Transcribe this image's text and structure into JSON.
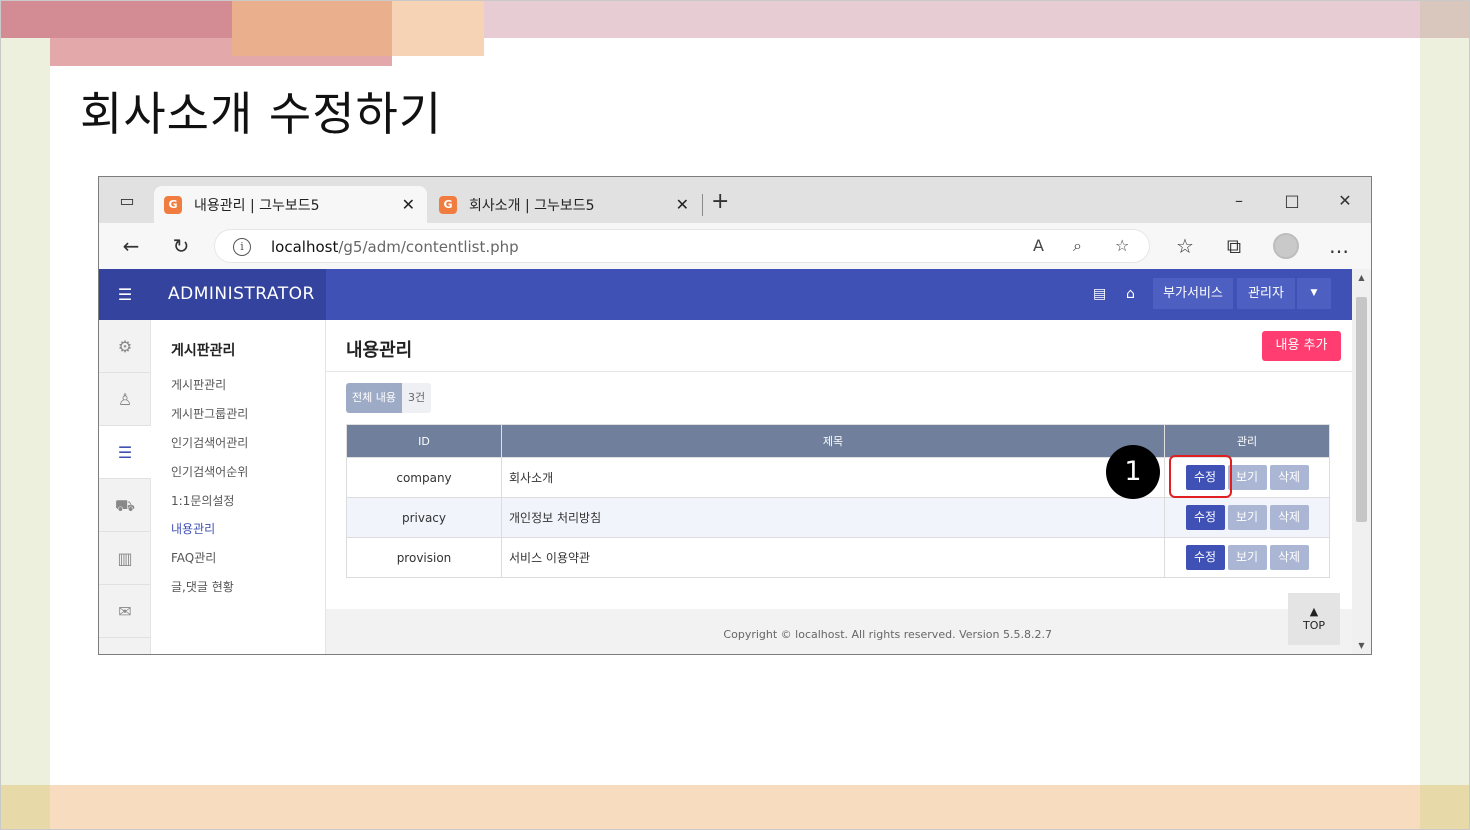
{
  "slide": {
    "title": "회사소개 수정하기",
    "step_number": "1"
  },
  "browser": {
    "tabs": [
      {
        "title": "내용관리 | 그누보드5",
        "active": true
      },
      {
        "title": "회사소개 | 그누보드5",
        "active": false
      }
    ],
    "url_host": "localhost",
    "url_path": "/g5/adm/contentlist.php"
  },
  "admin": {
    "brand": "ADMINISTRATOR",
    "header_buttons": {
      "addon": "부가서비스",
      "admin": "관리자"
    },
    "sidebar": {
      "title": "게시판관리",
      "items": [
        "게시판관리",
        "게시판그룹관리",
        "인기검색어관리",
        "인기검색어순위",
        "1:1문의설정",
        "내용관리",
        "FAQ관리",
        "글,댓글 현황"
      ],
      "active_item": "내용관리"
    },
    "page": {
      "title": "내용관리",
      "add_button": "내용 추가",
      "count_label": "전체 내용",
      "count_value": "3건"
    },
    "table": {
      "headers": [
        "ID",
        "제목",
        "관리"
      ],
      "rows": [
        {
          "id": "company",
          "title": "회사소개"
        },
        {
          "id": "privacy",
          "title": "개인정보 처리방침"
        },
        {
          "id": "provision",
          "title": "서비스 이용약관"
        }
      ],
      "actions": {
        "edit": "수정",
        "view": "보기",
        "delete": "삭제"
      }
    },
    "footer": {
      "copyright": "Copyright © localhost. All rights reserved. Version 5.5.8.2.7",
      "top_button": "TOP"
    }
  },
  "colors": {
    "header": "#3f51b5",
    "table_header": "#6f7f9c",
    "add_button": "#ff3d71",
    "highlight": "#e02020"
  }
}
